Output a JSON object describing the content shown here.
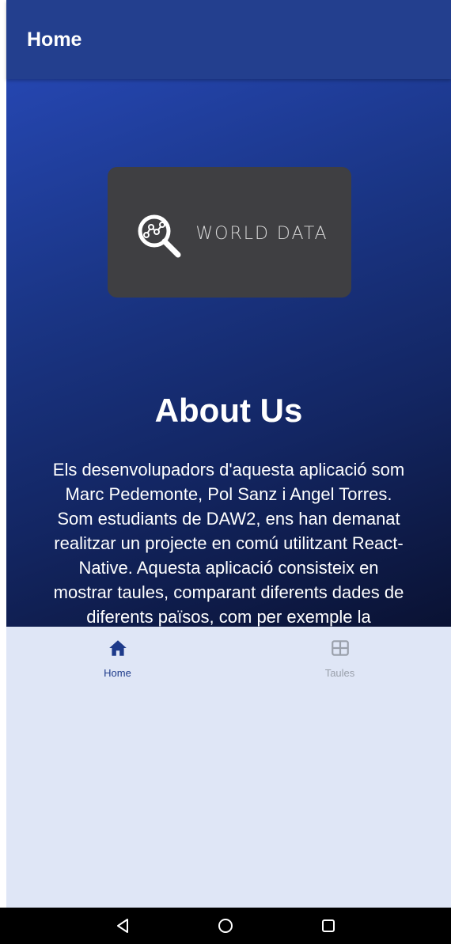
{
  "header": {
    "title": "Home"
  },
  "logo": {
    "text": "WORLD DATA",
    "icon": "magnifier-chart-icon"
  },
  "about": {
    "title": "About Us",
    "text": "Els desenvolupadors d'aquesta aplicació som Marc Pedemonte, Pol Sanz i Angel Torres. Som estudiants de DAW2, ens han demanat realitzar un projecte en comú utilitzant React-Native. Aquesta aplicació consisteix en mostrar taules, comparant diferents dades de diferents països, com per exemple la població, ferilitat o esperança de vida."
  },
  "tabs": [
    {
      "label": "Home",
      "icon": "home-icon",
      "active": true
    },
    {
      "label": "Taules",
      "icon": "table-icon",
      "active": false
    }
  ],
  "system_nav": {
    "back": "back-triangle-icon",
    "home": "home-circle-icon",
    "recents": "recents-square-icon"
  },
  "colors": {
    "header": "#233f8e",
    "gradient_top": "#2546b0",
    "gradient_bottom": "#0a1233",
    "logo_card": "#3f3f42",
    "tabbar": "#dfe6f6",
    "tab_active": "#1d3a8a",
    "tab_inactive": "#9aa0ab"
  }
}
